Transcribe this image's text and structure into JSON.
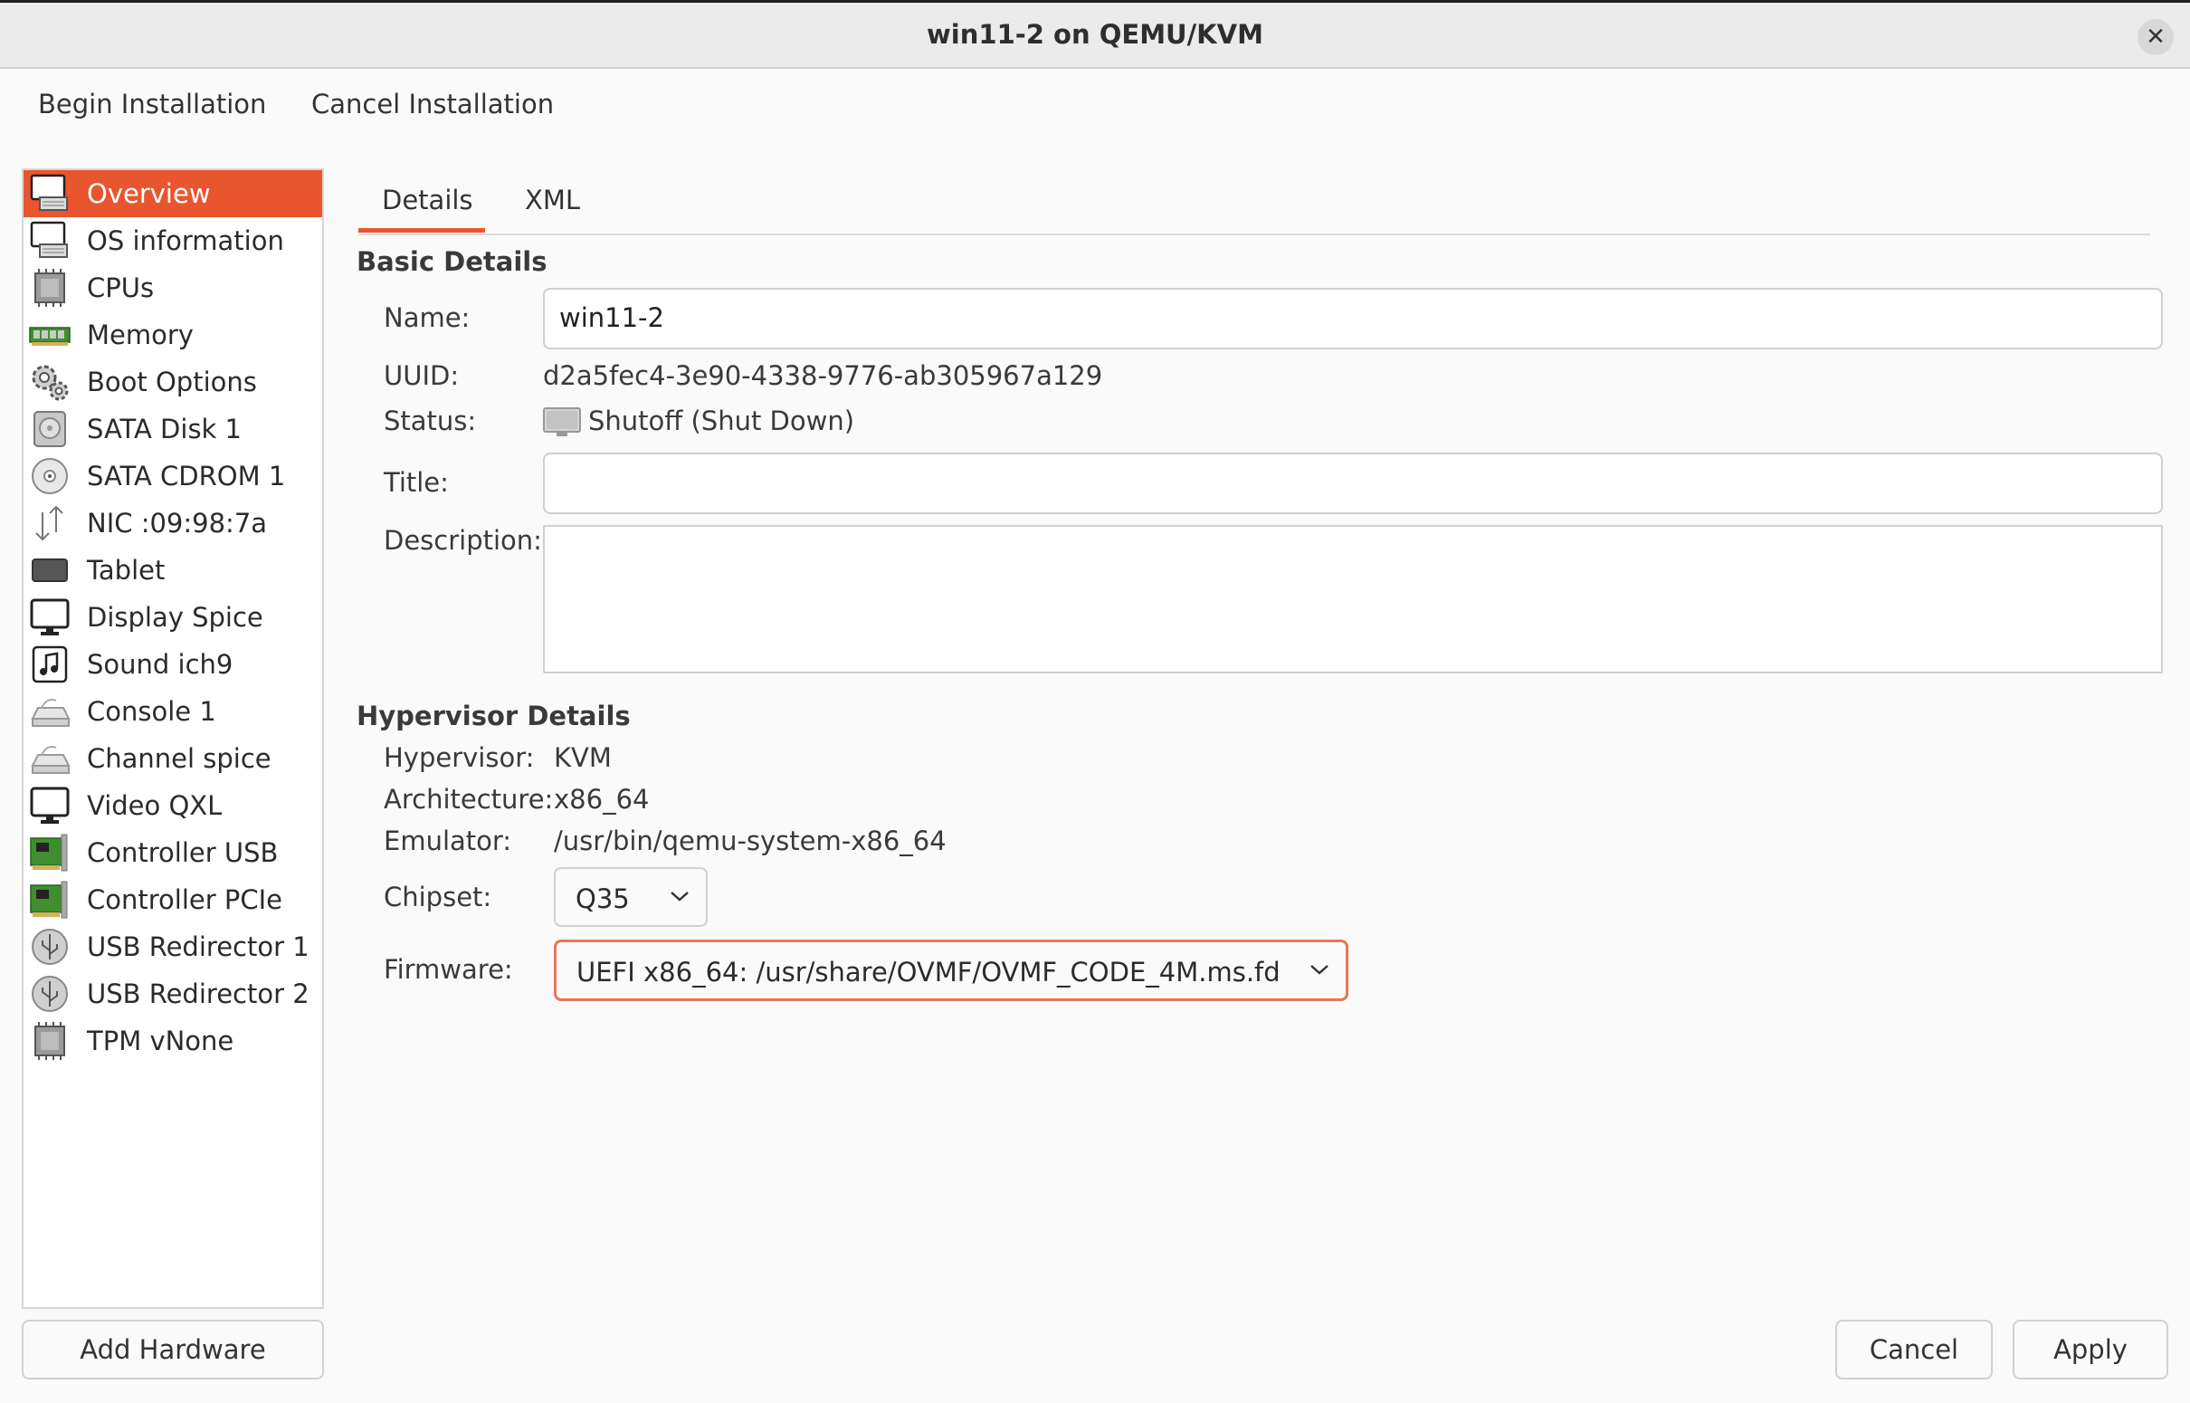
{
  "window": {
    "title": "win11-2 on QEMU/KVM",
    "close_symbol": "✕"
  },
  "toolbar": {
    "begin_label": "Begin Installation",
    "cancel_label": "Cancel Installation"
  },
  "sidebar": {
    "items": [
      {
        "label": "Overview",
        "icon": "monitor-keyboard-icon",
        "selected": true
      },
      {
        "label": "OS information",
        "icon": "monitor-keyboard-icon"
      },
      {
        "label": "CPUs",
        "icon": "cpu-chip-icon"
      },
      {
        "label": "Memory",
        "icon": "memory-stick-icon"
      },
      {
        "label": "Boot Options",
        "icon": "gears-icon"
      },
      {
        "label": "SATA Disk 1",
        "icon": "hard-disk-icon"
      },
      {
        "label": "SATA CDROM 1",
        "icon": "cdrom-icon"
      },
      {
        "label": "NIC :09:98:7a",
        "icon": "network-arrows-icon"
      },
      {
        "label": "Tablet",
        "icon": "tablet-icon"
      },
      {
        "label": "Display Spice",
        "icon": "display-monitor-icon"
      },
      {
        "label": "Sound ich9",
        "icon": "music-note-icon"
      },
      {
        "label": "Console 1",
        "icon": "serial-console-icon"
      },
      {
        "label": "Channel spice",
        "icon": "serial-channel-icon"
      },
      {
        "label": "Video QXL",
        "icon": "video-monitor-icon"
      },
      {
        "label": "Controller USB",
        "icon": "controller-card-icon"
      },
      {
        "label": "Controller PCIe",
        "icon": "controller-card-icon"
      },
      {
        "label": "USB Redirector 1",
        "icon": "usb-icon"
      },
      {
        "label": "USB Redirector 2",
        "icon": "usb-icon"
      },
      {
        "label": "TPM vNone",
        "icon": "tpm-chip-icon"
      }
    ],
    "add_hardware_label": "Add Hardware"
  },
  "tabs": [
    {
      "label": "Details",
      "active": true
    },
    {
      "label": "XML"
    }
  ],
  "basic": {
    "section_title": "Basic Details",
    "name_label": "Name:",
    "name_value": "win11-2",
    "uuid_label": "UUID:",
    "uuid_value": "d2a5fec4-3e90-4338-9776-ab305967a129",
    "status_label": "Status:",
    "status_value": "Shutoff (Shut Down)",
    "title_label": "Title:",
    "title_value": "",
    "description_label": "Description:",
    "description_value": ""
  },
  "hypervisor": {
    "section_title": "Hypervisor Details",
    "hypervisor_label": "Hypervisor:",
    "hypervisor_value": "KVM",
    "architecture_label": "Architecture:",
    "architecture_value": "x86_64",
    "emulator_label": "Emulator:",
    "emulator_value": "/usr/bin/qemu-system-x86_64",
    "chipset_label": "Chipset:",
    "chipset_value": "Q35",
    "firmware_label": "Firmware:",
    "firmware_value": "UEFI x86_64: /usr/share/OVMF/OVMF_CODE_4M.ms.fd"
  },
  "buttons": {
    "cancel_label": "Cancel",
    "apply_label": "Apply"
  },
  "colors": {
    "accent": "#e9552f",
    "focus_border": "#e9755a"
  }
}
